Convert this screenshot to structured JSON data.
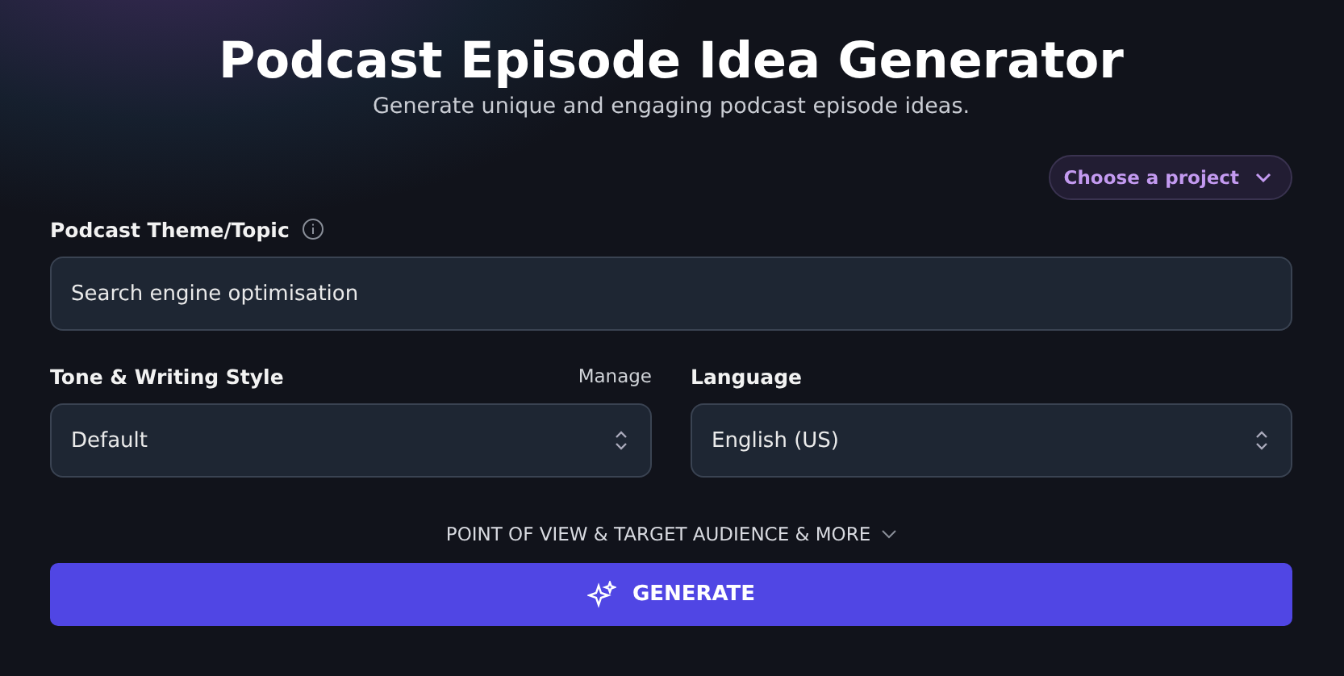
{
  "header": {
    "title": "Podcast Episode Idea Generator",
    "subtitle": "Generate unique and engaging podcast episode ideas."
  },
  "project_dropdown": {
    "label": "Choose a project"
  },
  "theme_field": {
    "label": "Podcast Theme/Topic",
    "value": "Search engine optimisation"
  },
  "tone_select": {
    "label": "Tone & Writing Style",
    "link": "Manage",
    "value": "Default"
  },
  "language_select": {
    "label": "Language",
    "value": "English (US)"
  },
  "more_options": {
    "label": "POINT OF VIEW & TARGET AUDIENCE & MORE",
    "expanded": false
  },
  "generate_button": {
    "label": "GENERATE"
  }
}
